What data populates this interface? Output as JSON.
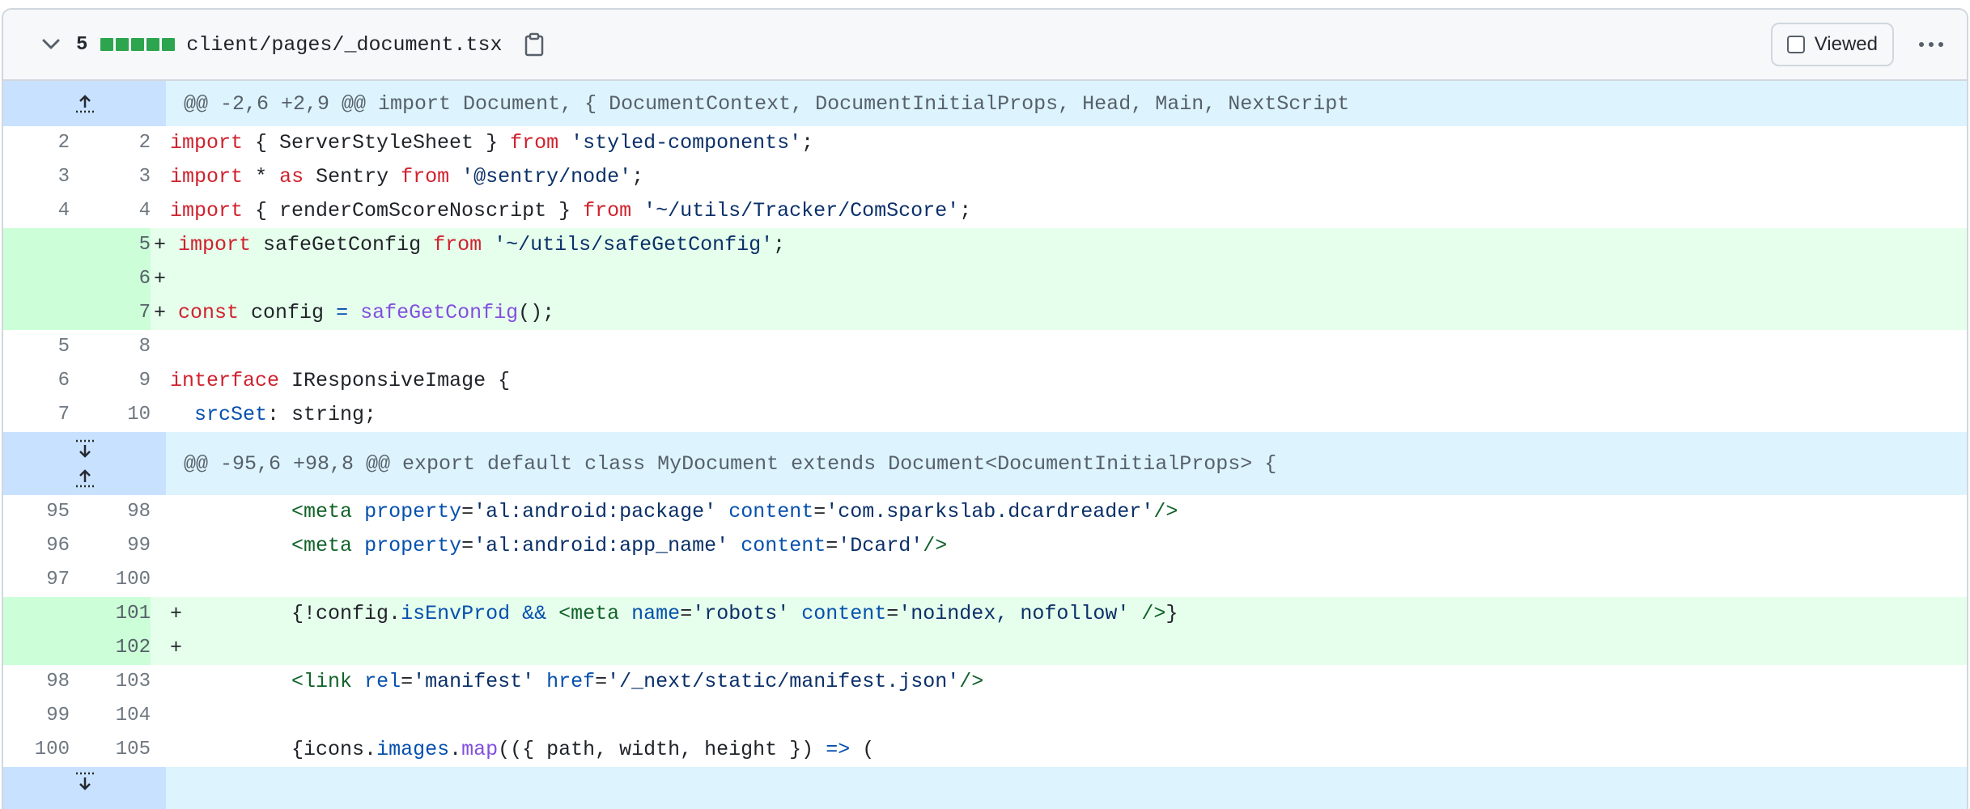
{
  "file": {
    "changes": "5",
    "path": "client/pages/_document.tsx",
    "viewed_label": "Viewed"
  },
  "hunks": [
    {
      "header": "@@ -2,6 +2,9 @@ import Document, { DocumentContext, DocumentInitialProps, Head, Main, NextScript"
    },
    {
      "header": "@@ -95,6 +98,8 @@ export default class MyDocument extends Document<DocumentInitialProps> {"
    }
  ],
  "lines": [
    {
      "old": "2",
      "new": "2",
      "type": "ctx"
    },
    {
      "old": "3",
      "new": "3",
      "type": "ctx"
    },
    {
      "old": "4",
      "new": "4",
      "type": "ctx"
    },
    {
      "old": "",
      "new": "5",
      "type": "add"
    },
    {
      "old": "",
      "new": "6",
      "type": "add"
    },
    {
      "old": "",
      "new": "7",
      "type": "add"
    },
    {
      "old": "5",
      "new": "8",
      "type": "ctx"
    },
    {
      "old": "6",
      "new": "9",
      "type": "ctx"
    },
    {
      "old": "7",
      "new": "10",
      "type": "ctx"
    },
    {
      "old": "95",
      "new": "98",
      "type": "ctx"
    },
    {
      "old": "96",
      "new": "99",
      "type": "ctx"
    },
    {
      "old": "97",
      "new": "100",
      "type": "ctx"
    },
    {
      "old": "",
      "new": "101",
      "type": "add"
    },
    {
      "old": "",
      "new": "102",
      "type": "add"
    },
    {
      "old": "98",
      "new": "103",
      "type": "ctx"
    },
    {
      "old": "99",
      "new": "104",
      "type": "ctx"
    },
    {
      "old": "100",
      "new": "105",
      "type": "ctx"
    }
  ],
  "code": {
    "l1": [
      "import",
      " { ServerStyleSheet } ",
      "from",
      " ",
      "'styled-components'",
      ";"
    ],
    "l2": [
      "import",
      " ",
      "*",
      " ",
      "as",
      " Sentry ",
      "from",
      " ",
      "'@sentry/node'",
      ";"
    ],
    "l3": [
      "import",
      " { renderComScoreNoscript } ",
      "from",
      " ",
      "'~/utils/Tracker/ComScore'",
      ";"
    ],
    "l4": [
      "+ ",
      "import",
      " safeGetConfig ",
      "from",
      " ",
      "'~/utils/safeGetConfig'",
      ";"
    ],
    "l5": [
      "+"
    ],
    "l6": [
      "+ ",
      "const",
      " config ",
      "=",
      " ",
      "safeGetConfig",
      "();"
    ],
    "l7": [
      ""
    ],
    "l8": [
      "interface",
      " IResponsiveImage {"
    ],
    "l9": [
      "  ",
      "srcSet",
      ": string;"
    ],
    "l10": [
      "          ",
      "<meta",
      " ",
      "property",
      "=",
      "'al:android:package'",
      " ",
      "content",
      "=",
      "'com.sparkslab.dcardreader'",
      "/>"
    ],
    "l11": [
      "          ",
      "<meta",
      " ",
      "property",
      "=",
      "'al:android:app_name'",
      " ",
      "content",
      "=",
      "'Dcard'",
      "/>"
    ],
    "l12": [
      ""
    ],
    "l13": [
      "+         ",
      "{!config.",
      "isEnvProd",
      " ",
      "&&",
      " ",
      "<meta",
      " ",
      "name",
      "=",
      "'robots'",
      " ",
      "content",
      "=",
      "'noindex, nofollow'",
      " ",
      "/>",
      "}"
    ],
    "l14": [
      "+"
    ],
    "l15": [
      "          ",
      "<link",
      " ",
      "rel",
      "=",
      "'manifest'",
      " ",
      "href",
      "=",
      "'/_next/static/manifest.json'",
      "/>"
    ],
    "l16": [
      ""
    ],
    "l17": [
      "          ",
      "{icons.",
      "images",
      ".",
      "map",
      "(({ path, width, height }) ",
      "=>",
      " ("
    ]
  },
  "colors": {
    "add_bg": "#e6ffec",
    "add_num_bg": "#ccffd8",
    "hunk_bg": "#ddf4ff",
    "hunk_expander_bg": "#c8e1ff",
    "keyword": "#cf222e",
    "string": "#0a3069",
    "function": "#8250df",
    "property": "#0550ae",
    "tag": "#116329",
    "diffstat": "#2da44e"
  },
  "icons": [
    "chevron-down-icon",
    "clipboard-icon",
    "expand-up-icon",
    "expand-down-icon",
    "kebab-icon",
    "checkbox-icon"
  ]
}
